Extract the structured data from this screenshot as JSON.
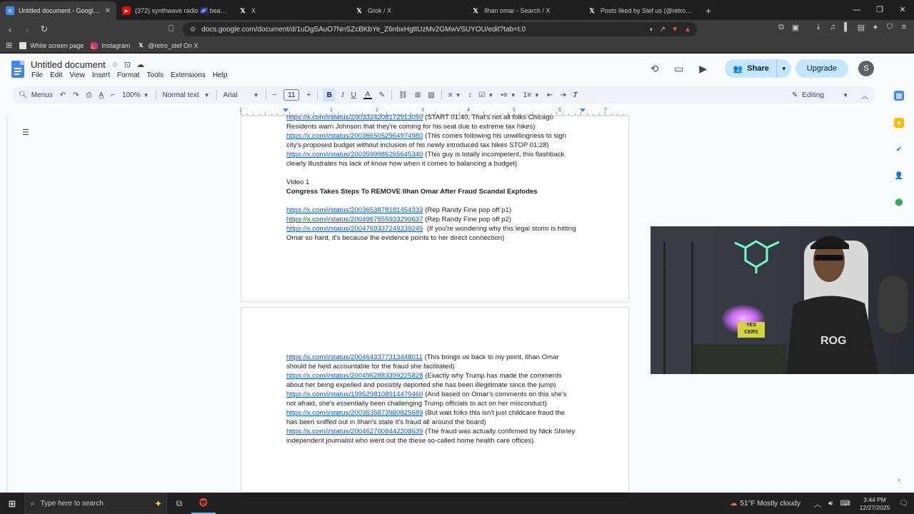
{
  "browser": {
    "tabs": [
      {
        "title": "Untitled document - Google Do",
        "favicon": "docs-icon",
        "active": true
      },
      {
        "title": "(372) synthwave radio 🌌 beats t",
        "favicon": "youtube-icon",
        "active": false
      },
      {
        "title": "X",
        "favicon": "x-icon",
        "active": false
      },
      {
        "title": "Grok / X",
        "favicon": "x-icon",
        "active": false
      },
      {
        "title": "Ilhan omar - Search / X",
        "favicon": "x-icon",
        "active": false
      },
      {
        "title": "Posts liked by Stef us (@retro_stef) /",
        "favicon": "x-icon",
        "active": false
      }
    ],
    "url": "docs.google.com/document/d/1uDgSAuO7NnSZcBKbYe_Z6nbxHgttUzMv2GMwVSUYOU/edit?tab=t.0",
    "bookmarks": [
      {
        "label": "White screen page",
        "icon": "page-icon"
      },
      {
        "label": "Instagram",
        "icon": "instagram-icon"
      },
      {
        "label": "@retro_stef On X",
        "icon": "x-icon"
      }
    ]
  },
  "docs": {
    "title": "Untitled document",
    "menu": [
      "File",
      "Edit",
      "View",
      "Insert",
      "Format",
      "Tools",
      "Extensions",
      "Help"
    ],
    "share_label": "Share",
    "upgrade_label": "Upgrade",
    "avatar_letter": "S",
    "toolbar": {
      "menus_label": "Menus",
      "zoom": "100%",
      "style": "Normal text",
      "font": "Arial",
      "font_size": "11",
      "bold": "B",
      "italic": "I",
      "underline": "U",
      "text_color": "A",
      "editing_label": "Editing"
    },
    "ruler_numbers": [
      "1",
      "1",
      "2",
      "3",
      "4",
      "5",
      "6",
      "7"
    ],
    "page1": [
      {
        "link": "https://x.com/i/status/2003324208172913050",
        "text": " (START 01:40, That's not all folks Chicago"
      },
      {
        "text": "Residents warn Johnson that they're coming for his seat due to extreme tax hikes)"
      },
      {
        "link": "https://x.com/i/status/2003665052964974980",
        "text": " (This comes following his unwillingness to sign"
      },
      {
        "text": "city's proposed budget without inclusion of his newly introduced tax hikes STOP 01:28)"
      },
      {
        "link": "https://x.com/i/status/2003599986265645340",
        "text": " (This guy is totally incompetent, this flashback"
      },
      {
        "text": "clearly illustrates his lack of know how when it comes to balancing a budget)"
      },
      {
        "text": ""
      },
      {
        "text": "Video 1"
      },
      {
        "text": "Congress Takes Steps To REMOVE Ilhan Omar After Fraud Scandal Explodes",
        "bold": true
      },
      {
        "text": ""
      },
      {
        "link": "https://x.com/i/status/2003653878181454333",
        "text": " (Rep Randy Fine pop off p1)"
      },
      {
        "link": "https://x.com/i/status/2004967555933290637",
        "text": " (Rep Randy Fine pop off p2)"
      },
      {
        "link": "https://x.com/i/status/2004769337249239245",
        "text": "  (If you're wondering why this legal storm is hitting"
      },
      {
        "text": "Omar so hard, it's because the evidence points to her direct connection)"
      }
    ],
    "page2": [
      {
        "link": "https://x.com/i/status/2004643377313448011",
        "text": " (This brings us back to my point, Ilhan Omar"
      },
      {
        "text": "should be held accountable for the fraud she facilitated)"
      },
      {
        "link": "https://x.com/i/status/2004962883399225828",
        "text": " (Exactly why Trump has made the comments"
      },
      {
        "text": "about her being expelled and possibly deported she has been illegitimate since the jump)"
      },
      {
        "link": "https://x.com/i/status/1995298108914479460",
        "text": " (And based on Omar's comments on this she's"
      },
      {
        "text": "not afraid, she's essentially been challenging Trump officials to act on her misconduct)"
      },
      {
        "link": "https://x.com/i/status/2003635873980825689",
        "text": " (But wait folks this isn't just childcare fraud the"
      },
      {
        "text": "has been sniffed out in Ilhan's state it's fraud all around the board)"
      },
      {
        "link": "https://x.com/i/status/2004627008442208639",
        "text": " (The fraud was actually confirmed by Nick Shirley"
      },
      {
        "text": "independent journalist who went out the these so-called home health care offices)"
      }
    ]
  },
  "webcam": {
    "pillow_text": "YES\nCERS",
    "shirt_text": "ROG"
  },
  "taskbar": {
    "search_placeholder": "Type here to search",
    "weather": "51°F  Mostly cloudy",
    "time": "3:44 PM",
    "date": "12/27/2025"
  },
  "colors": {
    "link": "#1155cc",
    "docs_blue": "#4285f4",
    "share_bg": "#c2e7ff",
    "toolbar_bg": "#edf2fa"
  }
}
